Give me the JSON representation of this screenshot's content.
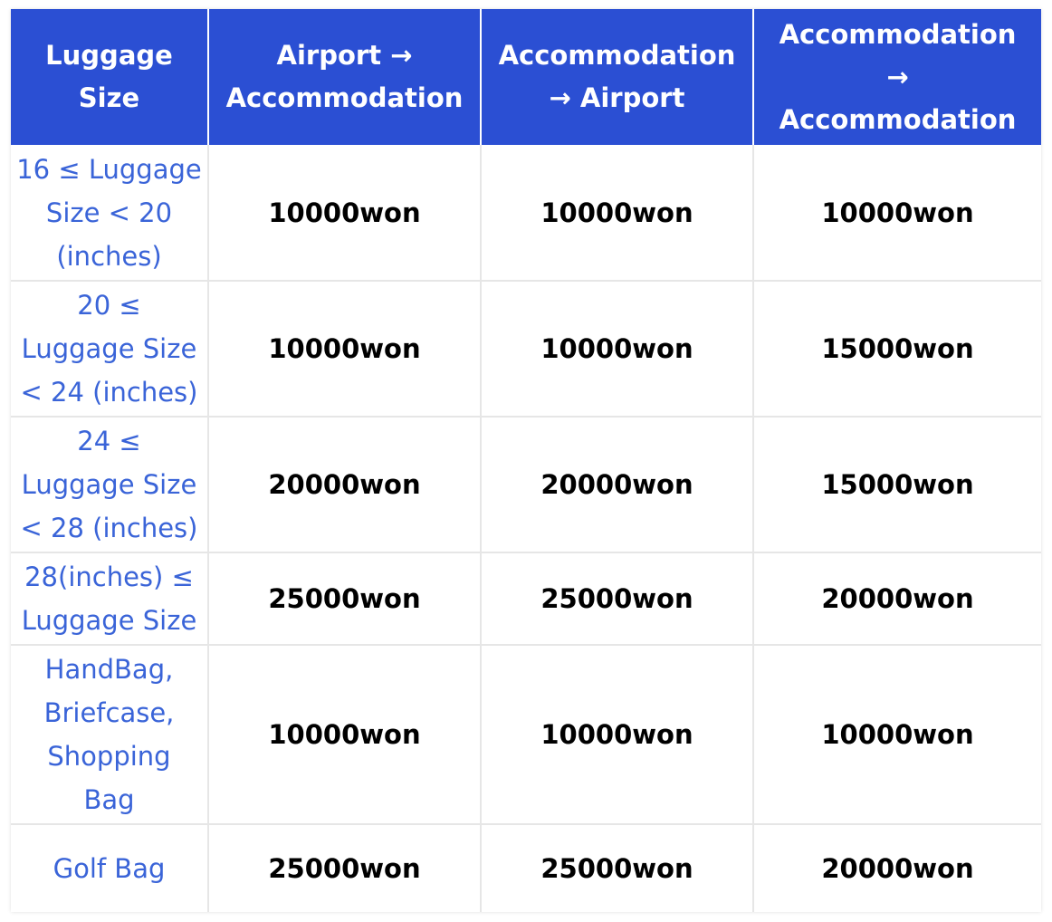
{
  "table": {
    "headers": [
      "Luggage\nSize",
      "Airport →\nAccommodation",
      "Accommodation\n→ Airport",
      "Accommodation\n→\nAccommodation"
    ],
    "rows": [
      {
        "size": "16 ≤ Luggage\nSize < 20\n(inches)",
        "prices": [
          "10000won",
          "10000won",
          "10000won"
        ]
      },
      {
        "size": "20 ≤\nLuggage Size\n< 24 (inches)",
        "prices": [
          "10000won",
          "10000won",
          "15000won"
        ]
      },
      {
        "size": "24 ≤\nLuggage Size\n< 28 (inches)",
        "prices": [
          "20000won",
          "20000won",
          "15000won"
        ]
      },
      {
        "size": "28(inches) ≤\nLuggage Size",
        "prices": [
          "25000won",
          "25000won",
          "20000won"
        ]
      },
      {
        "size": "HandBag,\nBriefcase,\nShopping\nBag",
        "prices": [
          "10000won",
          "10000won",
          "10000won"
        ]
      },
      {
        "size": "Golf Bag",
        "prices": [
          "25000won",
          "25000won",
          "20000won"
        ]
      }
    ]
  },
  "colors": {
    "header_bg": "#2b4fd3",
    "header_text": "#ffffff",
    "size_text": "#3a64d8",
    "price_text": "#000000",
    "grid_line": "#e6e6e6"
  }
}
